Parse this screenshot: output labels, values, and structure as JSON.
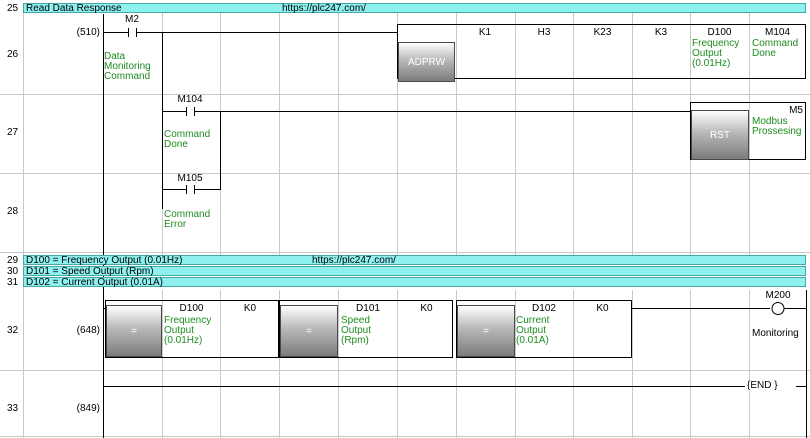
{
  "rung25": {
    "step": "25",
    "comment": "Read Data Response",
    "url": "https://plc247.com/"
  },
  "rung26": {
    "step": "26",
    "address": "(510)",
    "contact": {
      "device": "M2",
      "comment": "Data\nMonitoring\nCommand"
    },
    "instruction": "ADPRW",
    "operands": [
      {
        "device": "K1",
        "comment": ""
      },
      {
        "device": "H3",
        "comment": ""
      },
      {
        "device": "K23",
        "comment": ""
      },
      {
        "device": "K3",
        "comment": ""
      },
      {
        "device": "D100",
        "comment": "Frequency\nOutput\n(0.01Hz)"
      },
      {
        "device": "M104",
        "comment": "Command\nDone"
      }
    ]
  },
  "rung27": {
    "step": "27",
    "contact": {
      "device": "M104",
      "comment": "Command\nDone"
    },
    "instruction": "RST",
    "target": {
      "device": "M5",
      "comment": "Modbus\nProssesing"
    }
  },
  "rung28": {
    "step": "28",
    "contact": {
      "device": "M105",
      "comment": "Command\nError"
    }
  },
  "rung29": {
    "step": "29",
    "comment": "D100 = Frequency Output (0.01Hz)",
    "url": "https://plc247.com/"
  },
  "rung30": {
    "step": "30",
    "comment": "D101 = Speed Output (Rpm)"
  },
  "rung31": {
    "step": "31",
    "comment": "D102 = Current Output (0.01A)"
  },
  "rung32": {
    "step": "32",
    "address": "(648)",
    "compares": [
      {
        "op": "=",
        "device": "D100",
        "comment": "Frequency\nOutput\n(0.01Hz)",
        "k": "K0"
      },
      {
        "op": "=",
        "device": "D101",
        "comment": "Speed\nOutput\n(Rpm)",
        "k": "K0"
      },
      {
        "op": "=",
        "device": "D102",
        "comment": "Current\nOutput\n(0.01A)",
        "k": "K0"
      }
    ],
    "coil": {
      "device": "M200",
      "comment": "Monitoring"
    }
  },
  "rung33": {
    "step": "33",
    "address": "(849)",
    "end_label": "{END }"
  },
  "colors": {
    "comment_bar": "#8ff0f0",
    "label_green": "#1e8c1e",
    "grid": "#c0c0c0",
    "wire": "#000000"
  }
}
